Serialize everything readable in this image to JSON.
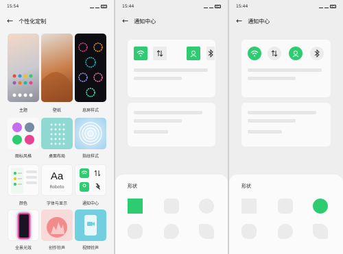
{
  "screen1": {
    "status": {
      "time": "15:54",
      "battery": "84"
    },
    "title": "个性化定制",
    "tiles": [
      {
        "label": "主题"
      },
      {
        "label": "壁纸"
      },
      {
        "label": "息屏样式"
      },
      {
        "label": "图标风格"
      },
      {
        "label": "桌面布局"
      },
      {
        "label": "指纹样式"
      },
      {
        "label": "颜色"
      },
      {
        "label": "字体与显示",
        "preview_text": "Aa",
        "preview_sub": "Roboto"
      },
      {
        "label": "通知中心"
      },
      {
        "label": "全景光效"
      },
      {
        "label": "创作铃声"
      },
      {
        "label": "视频铃声"
      }
    ]
  },
  "screen2": {
    "status": {
      "time": "15:44",
      "battery": "85"
    },
    "title": "通知中心",
    "sheet_title": "形状"
  },
  "screen3": {
    "status": {
      "time": "15:44",
      "battery": "85"
    },
    "title": "通知中心",
    "sheet_title": "形状"
  },
  "colors": {
    "accent": "#2ecc71",
    "accent_dark": "#27b864"
  }
}
